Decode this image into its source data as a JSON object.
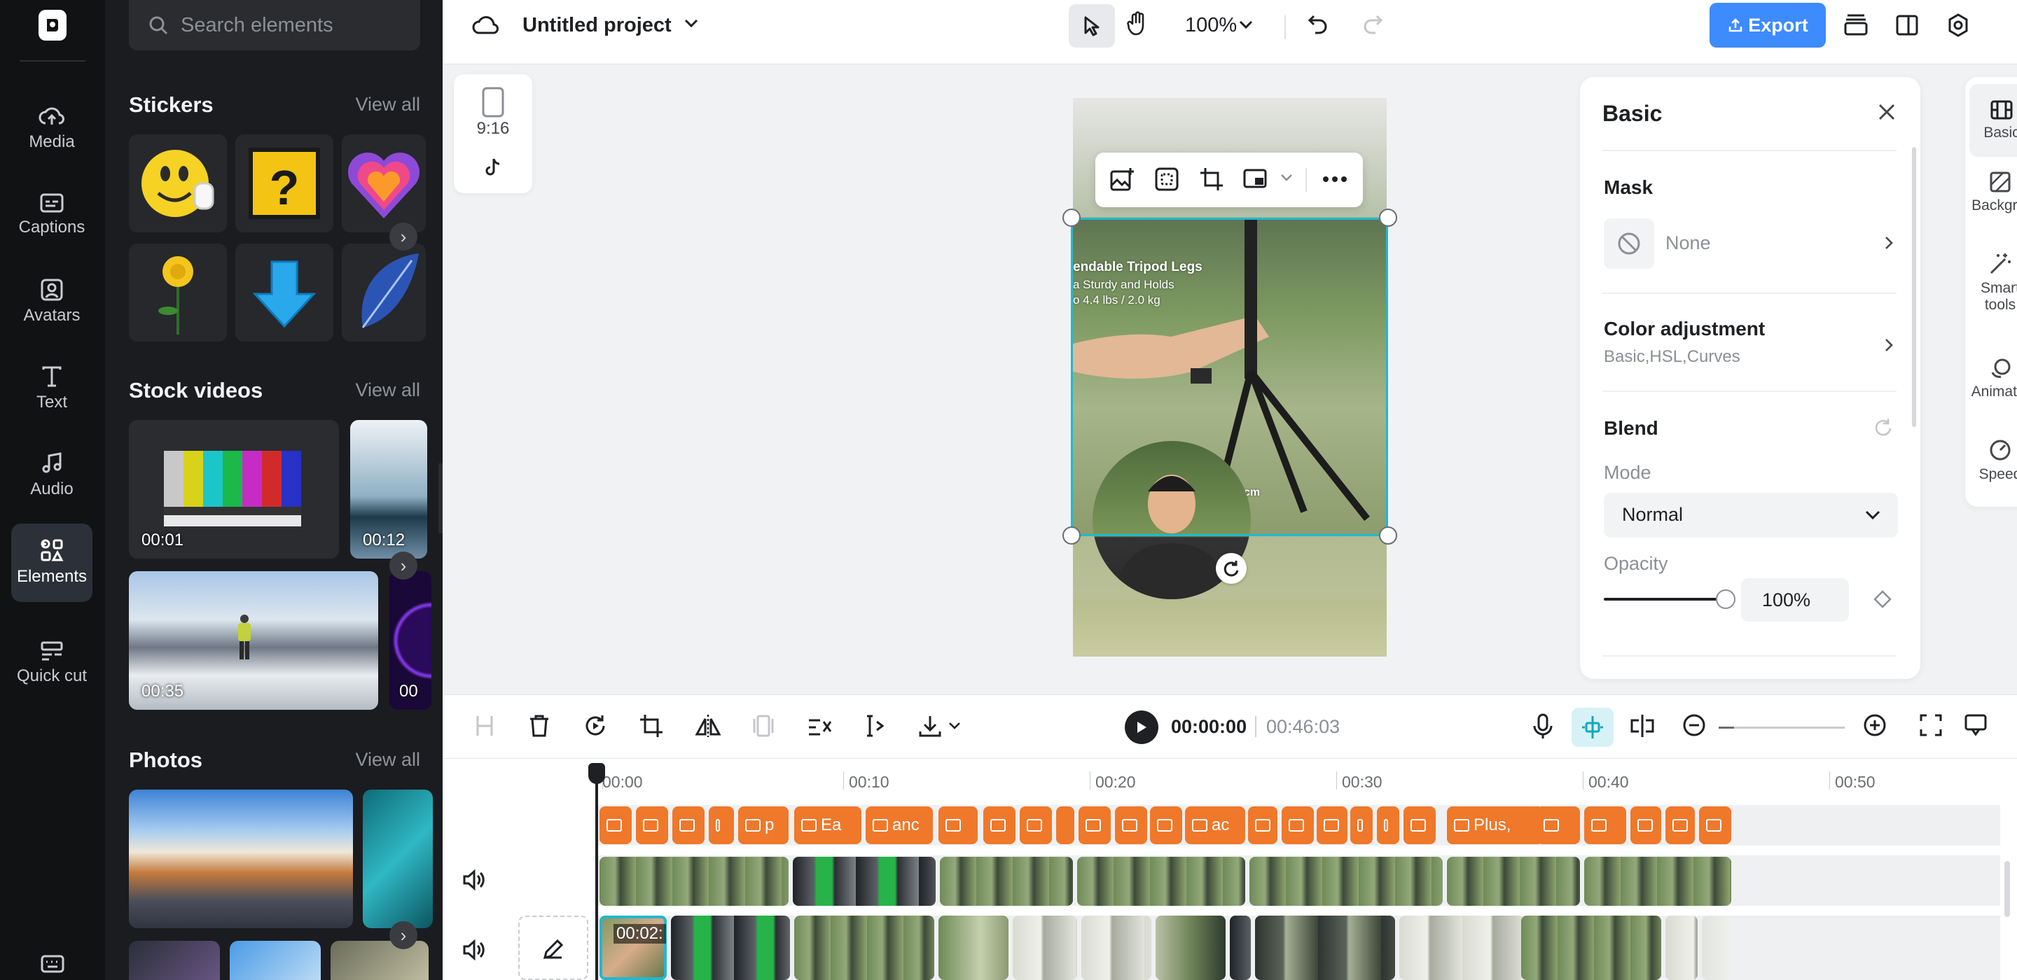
{
  "rail": {
    "items": [
      {
        "label": "Media",
        "icon": "cloud-upload-icon"
      },
      {
        "label": "Captions",
        "icon": "captions-icon"
      },
      {
        "label": "Avatars",
        "icon": "avatar-icon"
      },
      {
        "label": "Text",
        "icon": "text-icon"
      },
      {
        "label": "Audio",
        "icon": "music-note-icon"
      },
      {
        "label": "Elements",
        "icon": "elements-icon",
        "active": true
      },
      {
        "label": "Quick cut",
        "icon": "quick-cut-icon"
      }
    ]
  },
  "panel": {
    "search_placeholder": "Search elements",
    "stickers": {
      "title": "Stickers",
      "view_all": "View all"
    },
    "stock_videos": {
      "title": "Stock videos",
      "view_all": "View all",
      "durations": [
        "00:01",
        "00:12",
        "00:35",
        "00"
      ]
    },
    "photos": {
      "title": "Photos",
      "view_all": "View all"
    }
  },
  "topbar": {
    "project_title": "Untitled project",
    "zoom": "100%",
    "export_label": "Export"
  },
  "canvas": {
    "ratio_label": "9:16",
    "overlay_title": "endable Tripod Legs",
    "overlay_line1": "a Sturdy and Holds",
    "overlay_line2": "o 4.4 lbs / 2.0 kg",
    "overlay_cm": "cm"
  },
  "props": {
    "title": "Basic",
    "mask": {
      "title": "Mask",
      "value": "None"
    },
    "color_adjustment": {
      "title": "Color adjustment",
      "subtitle": "Basic,HSL,Curves"
    },
    "blend": {
      "title": "Blend",
      "mode_label": "Mode",
      "mode_value": "Normal",
      "opacity_label": "Opacity",
      "opacity_value": "100%",
      "opacity": 1.0
    }
  },
  "side_tabs": [
    {
      "label": "Basic",
      "active": true
    },
    {
      "label": "Backgr..."
    },
    {
      "label": "Smart tools"
    },
    {
      "label": "Animat..."
    },
    {
      "label": "Speed"
    }
  ],
  "timeline": {
    "current_time": "00:00:00",
    "total_time": "00:46:03",
    "ticks": [
      "00:00",
      "00:10",
      "00:20",
      "00:30",
      "00:40",
      "00:50"
    ],
    "caption_texts": [
      "p",
      "Ea",
      "anc",
      "ac",
      "Plus,"
    ],
    "selected_clip_time": "00:02:"
  }
}
